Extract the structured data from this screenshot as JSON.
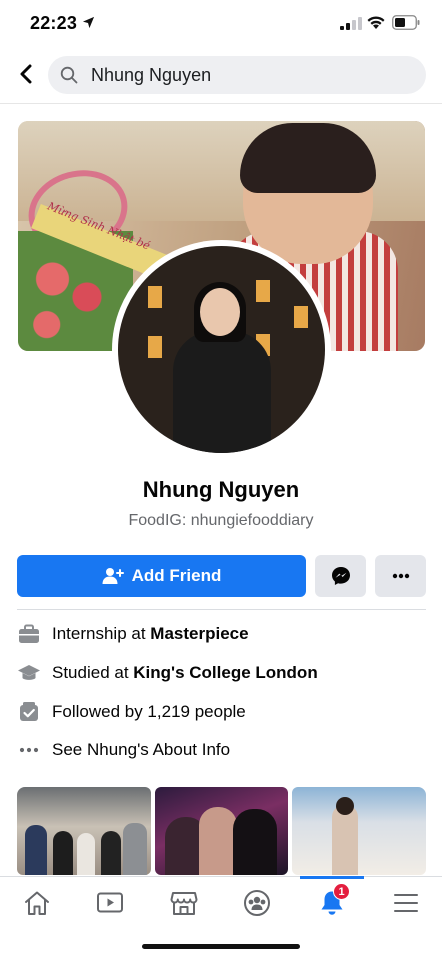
{
  "status_bar": {
    "time": "22:23",
    "icons": [
      "location-arrow-icon",
      "signal-icon",
      "wifi-icon",
      "battery-icon"
    ]
  },
  "header": {
    "back_icon": "chevron-left-icon",
    "search_icon": "search-icon",
    "search_value": "Nhung Nguyen"
  },
  "profile": {
    "name": "Nhung Nguyen",
    "bio": "FoodIG: nhungiefooddiary",
    "cover_caption": "Mừng Sinh Nhật bé"
  },
  "actions": {
    "add_friend_label": "Add Friend",
    "add_friend_icon": "add-friend-icon",
    "messenger_icon": "messenger-icon",
    "more_icon": "more-dots-icon"
  },
  "info": [
    {
      "icon": "briefcase-icon",
      "prefix": "Internship at ",
      "bold": "Masterpiece"
    },
    {
      "icon": "graduation-cap-icon",
      "prefix": "Studied at ",
      "bold": "King's College London"
    },
    {
      "icon": "followers-icon",
      "prefix": "Followed by 1,219 people",
      "bold": ""
    },
    {
      "icon": "more-dots-icon",
      "prefix": "See Nhung's About Info",
      "bold": ""
    }
  ],
  "photos": [
    "photo-group-outdoor",
    "photo-party-friends",
    "photo-beach-portrait"
  ],
  "bottom_nav": {
    "items": [
      "home-icon",
      "video-icon",
      "marketplace-icon",
      "groups-icon",
      "notifications-icon",
      "menu-icon"
    ],
    "active": "notifications-icon",
    "notification_count": "1"
  },
  "colors": {
    "accent": "#1877f2",
    "badge": "#e41e3f",
    "secondary_text": "#65676b",
    "button_gray": "#e4e6eb"
  }
}
